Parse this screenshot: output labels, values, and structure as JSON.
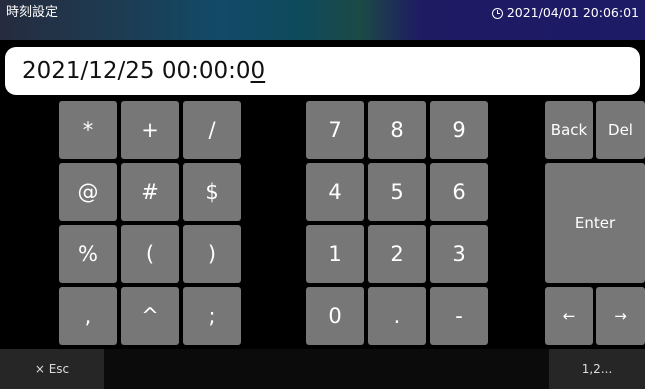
{
  "titlebar": {
    "title": "時刻設定",
    "clock_icon": "clock-icon",
    "datetime": "2021/04/01 20:06:01"
  },
  "input": {
    "value_main": "2021/12/25  00:00:0",
    "value_cursor": "0"
  },
  "keypad_symbols": [
    "*",
    "+",
    "/",
    "@",
    "#",
    "$",
    "%",
    "(",
    ")",
    ",",
    "^",
    ";"
  ],
  "keypad_numbers": [
    "7",
    "8",
    "9",
    "4",
    "5",
    "6",
    "1",
    "2",
    "3",
    "0",
    ".",
    "-"
  ],
  "actions": {
    "back": "Back",
    "del": "Del",
    "enter": "Enter",
    "left": "←",
    "right": "→"
  },
  "bottom": {
    "esc": "× Esc",
    "mode": "1,2..."
  }
}
